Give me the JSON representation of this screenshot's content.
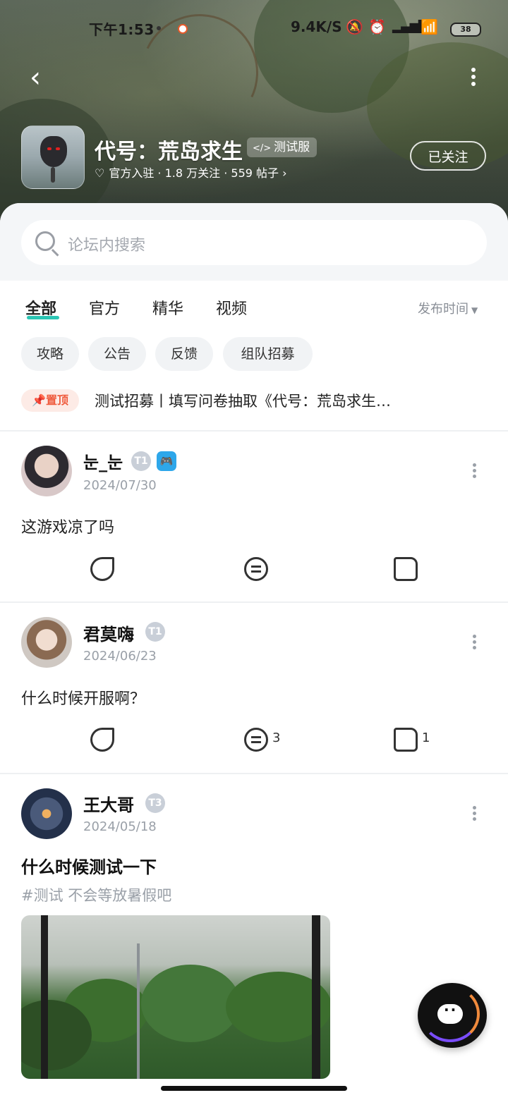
{
  "status_bar": {
    "time": "下午1:53",
    "network_speed": "9.4K/S",
    "battery": "38"
  },
  "header": {
    "game_title": "代号：荒岛求生",
    "beta_tag": "测试服",
    "meta_line": "官方入驻 · 1.8 万关注 · 559 帖子 ›",
    "follow_button": "已关注"
  },
  "search": {
    "placeholder": "论坛内搜索"
  },
  "tabs": [
    {
      "label": "全部"
    },
    {
      "label": "官方"
    },
    {
      "label": "精华"
    },
    {
      "label": "视频"
    }
  ],
  "sort_label": "发布时间",
  "chips": [
    {
      "label": "攻略"
    },
    {
      "label": "公告"
    },
    {
      "label": "反馈"
    },
    {
      "label": "组队招募"
    }
  ],
  "pinned": {
    "badge": "置顶",
    "text": "测试招募丨填写问卷抽取《代号：荒岛求生…"
  },
  "posts": [
    {
      "author": "눈_눈",
      "level": "T1",
      "date": "2024/07/30",
      "body": "这游戏凉了吗",
      "comments": "",
      "likes": ""
    },
    {
      "author": "君莫嗨",
      "level": "T1",
      "date": "2024/06/23",
      "body": "什么时候开服啊？",
      "comments": "3",
      "likes": "1"
    },
    {
      "author": "王大哥",
      "level": "T3",
      "date": "2024/05/18",
      "title": "什么时候测试一下",
      "tag_line": "#测试 不会等放暑假吧"
    }
  ],
  "colors": {
    "accent": "#2bc5b4",
    "pin": "#ef5a3c"
  }
}
